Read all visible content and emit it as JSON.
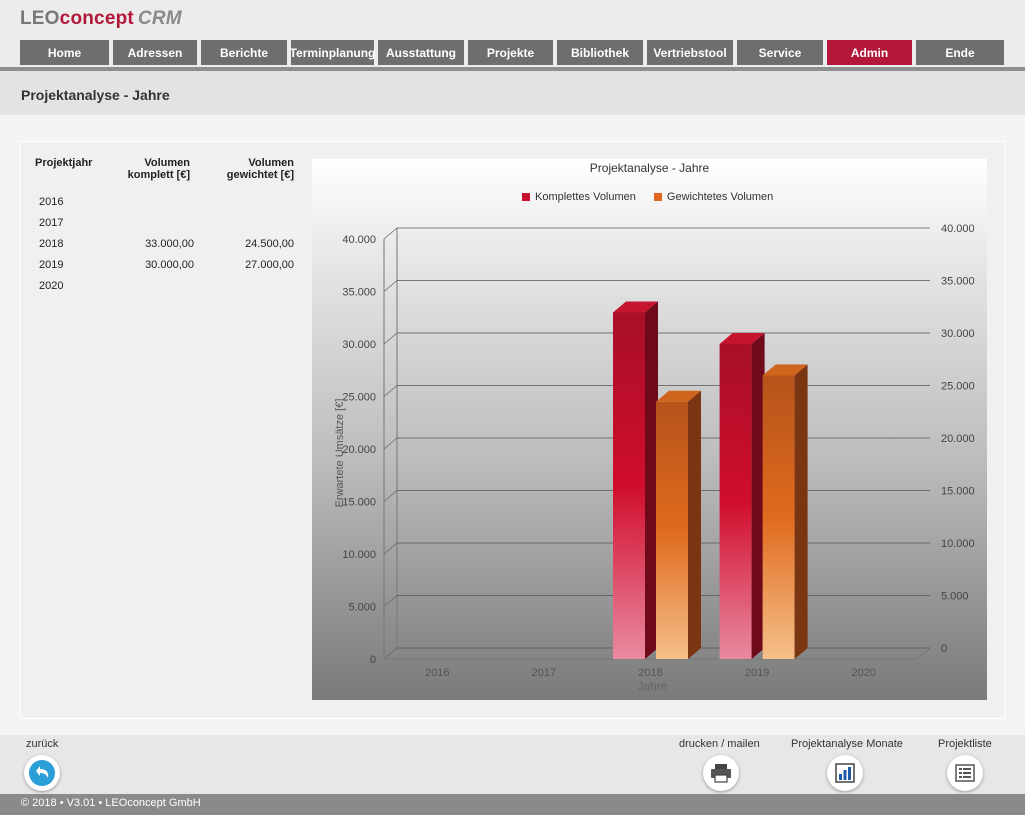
{
  "app": {
    "logo_leo": "LEO",
    "logo_concept": "concept",
    "logo_crm": "CRM"
  },
  "nav": [
    {
      "label": "Home",
      "active": false
    },
    {
      "label": "Adressen",
      "active": false
    },
    {
      "label": "Berichte",
      "active": false
    },
    {
      "label": "Terminplanung",
      "active": false
    },
    {
      "label": "Ausstattung",
      "active": false
    },
    {
      "label": "Projekte",
      "active": false
    },
    {
      "label": "Bibliothek",
      "active": false
    },
    {
      "label": "Vertriebstool",
      "active": false
    },
    {
      "label": "Service",
      "active": false
    },
    {
      "label": "Admin",
      "active": true
    },
    {
      "label": "Ende",
      "active": false
    }
  ],
  "page": {
    "title": "Projektanalyse - Jahre"
  },
  "table": {
    "headers": [
      "Projektjahr",
      "Volumen komplett [€]",
      "Volumen gewichtet [€]"
    ],
    "header_lines": {
      "c2": [
        "Volumen",
        "komplett [€]"
      ],
      "c3": [
        "Volumen",
        "gewichtet [€]"
      ]
    },
    "rows": [
      {
        "year": "2016",
        "komplett": "",
        "gewichtet": ""
      },
      {
        "year": "2017",
        "komplett": "",
        "gewichtet": ""
      },
      {
        "year": "2018",
        "komplett": "33.000,00",
        "gewichtet": "24.500,00"
      },
      {
        "year": "2019",
        "komplett": "30.000,00",
        "gewichtet": "27.000,00"
      },
      {
        "year": "2020",
        "komplett": "",
        "gewichtet": ""
      }
    ]
  },
  "chart_data": {
    "type": "bar",
    "title": "Projektanalyse - Jahre",
    "xlabel": "Jahre",
    "ylabel": "Erwartete Umsätze [€]",
    "categories": [
      "2016",
      "2017",
      "2018",
      "2019",
      "2020"
    ],
    "series": [
      {
        "name": "Komplettes Volumen",
        "color": "#c8102e",
        "values": [
          0,
          0,
          33000,
          30000,
          0
        ]
      },
      {
        "name": "Gewichtetes Volumen",
        "color": "#e0661e",
        "values": [
          0,
          0,
          24500,
          27000,
          0
        ]
      }
    ],
    "ylim": [
      0,
      40000
    ],
    "yticks": [
      "0",
      "5.000",
      "10.000",
      "15.000",
      "20.000",
      "25.000",
      "30.000",
      "35.000",
      "40.000"
    ],
    "secondary_yticks": [
      "0",
      "5.000",
      "10.000",
      "15.000",
      "20.000",
      "25.000",
      "30.000",
      "35.000",
      "40.000"
    ],
    "legend_position": "top",
    "grid": true,
    "style": "3d"
  },
  "footer": {
    "back_label": "zurück",
    "print_label": "drucken / mailen",
    "months_label": "Projektanalyse Monate",
    "list_label": "Projektliste",
    "copyright": "© 2018 • V3.01 • LEOconcept GmbH"
  },
  "icons": {
    "back": "back-arrow-icon",
    "print": "printer-icon",
    "months": "bar-chart-icon",
    "list": "list-icon"
  }
}
